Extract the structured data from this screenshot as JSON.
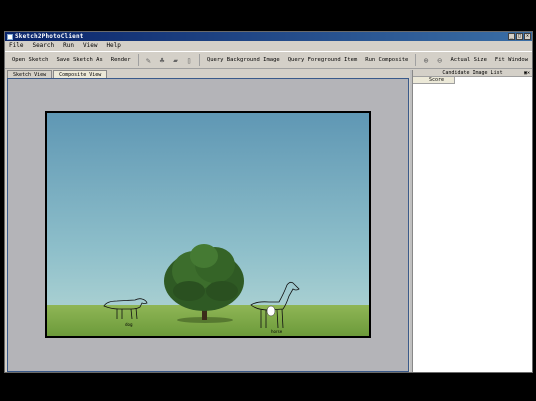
{
  "window": {
    "title": "Sketch2PhotoClient",
    "controls": [
      "minimize-icon",
      "maximize-icon",
      "close-icon"
    ]
  },
  "menu": {
    "items": [
      "File",
      "Search",
      "Run",
      "View",
      "Help"
    ]
  },
  "toolbar": {
    "open_sketch": "Open Sketch",
    "save_sketch_as": "Save Sketch As",
    "render": "Render",
    "query_background": "Query Background Image",
    "query_foreground": "Query Foreground Item",
    "run_composite": "Run Composite",
    "actual_size": "Actual Size",
    "fit_window": "Fit Window",
    "icons": [
      "pen-icon",
      "tree-icon",
      "car-icon",
      "page-icon",
      "zoom-in-icon",
      "zoom-out-icon"
    ]
  },
  "tabs": [
    {
      "label": "Sketch View",
      "active": false
    },
    {
      "label": "Composite View",
      "active": true
    }
  ],
  "canvas": {
    "sketch_labels": [
      "dog",
      "horse"
    ]
  },
  "side_panel": {
    "title": "Candidate Image List",
    "column_header": "Score",
    "controls": "▣✕"
  },
  "colors": {
    "titlebar": "#0a246a",
    "viewport": "#b4b4b8",
    "sky": "#6fa3b8",
    "grass": "#7ea84a"
  }
}
